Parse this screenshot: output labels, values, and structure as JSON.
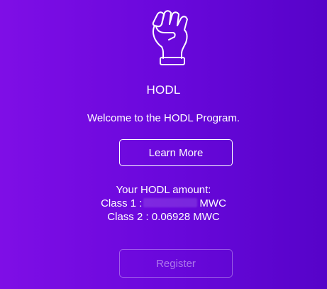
{
  "header": {
    "icon": "raised-fist-icon",
    "title": "HODL"
  },
  "welcome_text": "Welcome to the HODL Program.",
  "learn_more_label": "Learn More",
  "amount": {
    "heading": "Your HODL amount:",
    "class1_label": "Class 1 :",
    "class1_value_redacted": true,
    "class1_unit": "MWC",
    "class2_text": "Class 2 : 0.06928 MWC"
  },
  "register_label": "Register",
  "colors": {
    "background_left": "#7f0ee6",
    "background_right": "#5603c9",
    "text": "#ffffff"
  }
}
